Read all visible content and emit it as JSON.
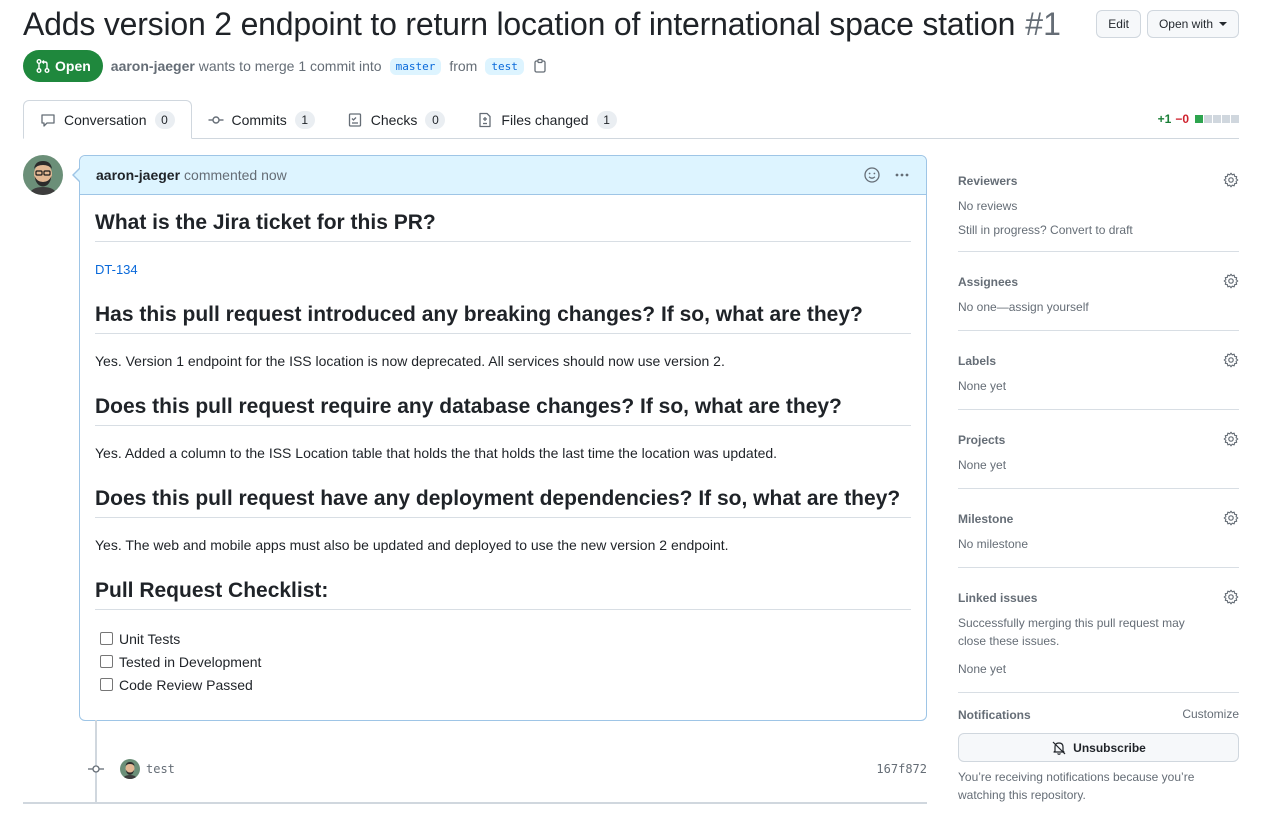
{
  "pr": {
    "title": "Adds version 2 endpoint to return location of international space station",
    "number": "#1",
    "edit_label": "Edit",
    "open_with_label": "Open with",
    "state": "Open",
    "author": "aaron-jaeger",
    "merge_text": "wants to merge 1 commit into",
    "base_branch": "master",
    "from_text": "from",
    "head_branch": "test"
  },
  "tabs": [
    {
      "label": "Conversation",
      "count": "0",
      "icon": "comment-icon"
    },
    {
      "label": "Commits",
      "count": "1",
      "icon": "commit-icon"
    },
    {
      "label": "Checks",
      "count": "0",
      "icon": "checks-icon"
    },
    {
      "label": "Files changed",
      "count": "1",
      "icon": "file-diff-icon"
    }
  ],
  "diffstat": {
    "additions": "+1",
    "deletions": "−0"
  },
  "comment": {
    "author": "aaron-jaeger",
    "when": "commented now",
    "q1": "What is the Jira ticket for this PR?",
    "a1_link": "DT-134",
    "q2": "Has this pull request introduced any breaking changes? If so, what are they?",
    "a2": "Yes. Version 1 endpoint for the ISS location is now deprecated. All services should now use version 2.",
    "q3": "Does this pull request require any database changes? If so, what are they?",
    "a3": "Yes. Added a column to the ISS Location table that holds the that holds the last time the location was updated.",
    "q4": "Does this pull request have any deployment dependencies? If so, what are they?",
    "a4": "Yes. The web and mobile apps must also be updated and deployed to use the new version 2 endpoint.",
    "checklist_title": "Pull Request Checklist:",
    "checklist": [
      "Unit Tests",
      "Tested in Development",
      "Code Review Passed"
    ]
  },
  "commit": {
    "message": "test",
    "sha": "167f872"
  },
  "sidebar": {
    "reviewers": {
      "title": "Reviewers",
      "text": "No reviews",
      "link": "Still in progress? Convert to draft"
    },
    "assignees": {
      "title": "Assignees",
      "text": "No one—assign yourself"
    },
    "labels": {
      "title": "Labels",
      "text": "None yet"
    },
    "projects": {
      "title": "Projects",
      "text": "None yet"
    },
    "milestone": {
      "title": "Milestone",
      "text": "No milestone"
    },
    "linked": {
      "title": "Linked issues",
      "text": "Successfully merging this pull request may close these issues.",
      "text2": "None yet"
    },
    "notifications": {
      "title": "Notifications",
      "customize": "Customize",
      "button": "Unsubscribe",
      "note": "You’re receiving notifications because you’re watching this repository."
    }
  },
  "colors": {
    "open_green": "#1f883d",
    "link_blue": "#0969da",
    "comment_header": "#ddf4ff"
  }
}
